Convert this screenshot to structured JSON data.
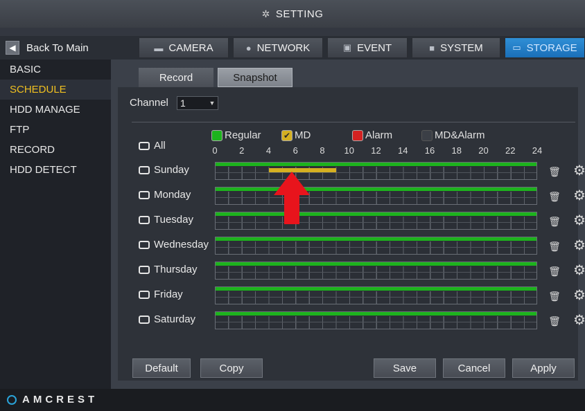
{
  "window": {
    "title": "SETTING"
  },
  "nav": {
    "back_label": "Back To Main",
    "tabs": [
      {
        "label": "CAMERA",
        "icon": "camera-icon"
      },
      {
        "label": "NETWORK",
        "icon": "globe-icon"
      },
      {
        "label": "EVENT",
        "icon": "event-icon"
      },
      {
        "label": "SYSTEM",
        "icon": "system-icon"
      },
      {
        "label": "STORAGE",
        "icon": "monitor-icon"
      }
    ],
    "active_tab": "STORAGE"
  },
  "sidebar": {
    "items": [
      {
        "label": "BASIC"
      },
      {
        "label": "SCHEDULE"
      },
      {
        "label": "HDD MANAGE"
      },
      {
        "label": "FTP"
      },
      {
        "label": "RECORD"
      },
      {
        "label": "HDD DETECT"
      }
    ],
    "active_item": "SCHEDULE"
  },
  "subtabs": {
    "record": "Record",
    "snapshot": "Snapshot",
    "active": "Snapshot"
  },
  "channel": {
    "label": "Channel",
    "value": "1"
  },
  "legend": {
    "regular": "Regular",
    "md": "MD",
    "alarm": "Alarm",
    "md_alarm": "MD&Alarm",
    "colors": {
      "regular": "#1db31d",
      "md": "#d4b021",
      "alarm": "#d42222",
      "md_alarm": "#3b3f46"
    }
  },
  "all_label": "All",
  "hour_ticks": [
    "0",
    "2",
    "4",
    "6",
    "8",
    "10",
    "12",
    "14",
    "16",
    "18",
    "20",
    "22",
    "24"
  ],
  "days": [
    {
      "label": "Sunday",
      "regular_hours": [
        0,
        24
      ],
      "md_hours": [
        4,
        9
      ]
    },
    {
      "label": "Monday",
      "regular_hours": [
        0,
        24
      ]
    },
    {
      "label": "Tuesday",
      "regular_hours": [
        0,
        24
      ]
    },
    {
      "label": "Wednesday",
      "regular_hours": [
        0,
        24
      ]
    },
    {
      "label": "Thursday",
      "regular_hours": [
        0,
        24
      ]
    },
    {
      "label": "Friday",
      "regular_hours": [
        0,
        24
      ]
    },
    {
      "label": "Saturday",
      "regular_hours": [
        0,
        24
      ]
    }
  ],
  "buttons": {
    "default": "Default",
    "copy": "Copy",
    "save": "Save",
    "cancel": "Cancel",
    "apply": "Apply"
  },
  "brand": {
    "name": "AMCREST",
    "accent": "#2aa3d8"
  }
}
